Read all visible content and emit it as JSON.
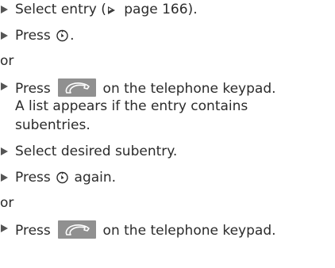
{
  "lines": {
    "l1_pre": "Select entry (",
    "l1_post": " page 166).",
    "l2_pre": "Press ",
    "l2_post": ".",
    "or1": "or",
    "l3_pre": "Press ",
    "l3_post": " on the telephone keypad.",
    "l3_cont1": "A list appears if the entry contains",
    "l3_cont2": "subentries.",
    "l4": "Select desired subentry.",
    "l5_pre": "Press ",
    "l5_post": " again.",
    "or2": "or",
    "l6_pre": "Press ",
    "l6_post": " on the telephone keypad."
  },
  "icons": {
    "step_marker": "triangle-right-icon",
    "page_reference": "page-reference-triangle-icon",
    "controller": "controller-knob-icon",
    "phone_key": "phone-send-key-icon"
  },
  "colors": {
    "text": "#2b2b2b",
    "marker": "#555555",
    "key_background": "#909090",
    "key_glyph": "#ffffff"
  }
}
